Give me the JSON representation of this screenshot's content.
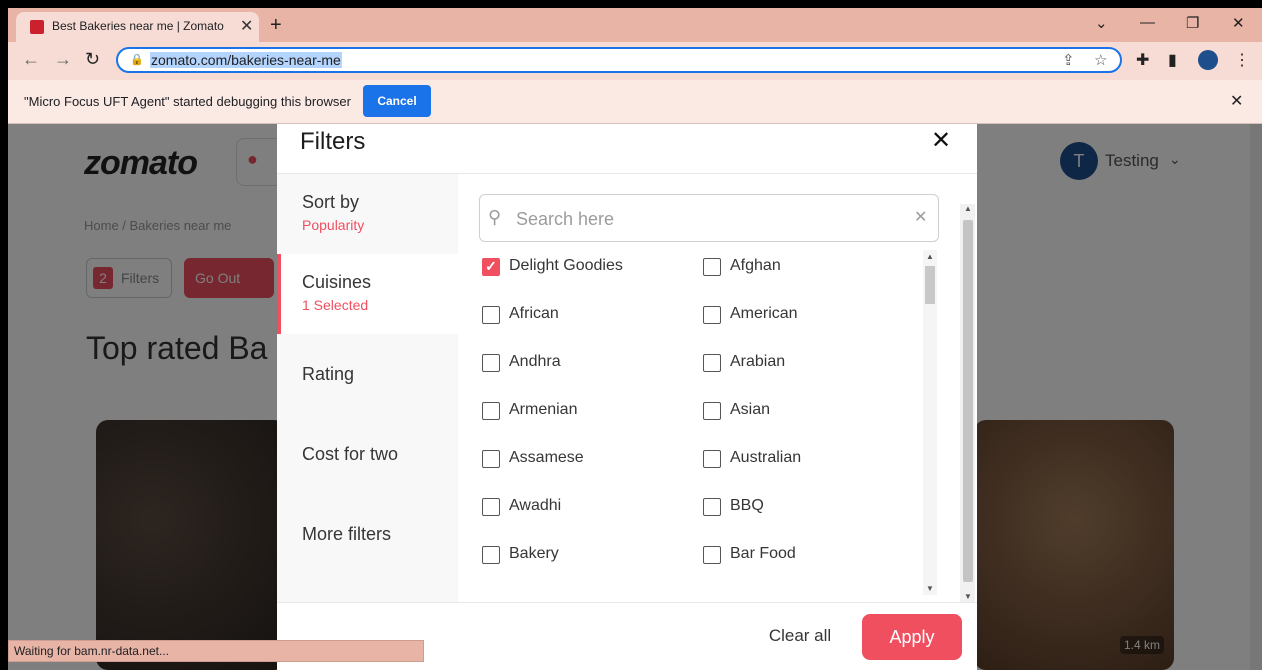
{
  "browser": {
    "tab_title": "Best Bakeries near me | Zomato",
    "url": "zomato.com/bakeries-near-me",
    "infobar_text": "\"Micro Focus UFT Agent\" started debugging this browser",
    "infobar_cancel": "Cancel",
    "status_text": "Waiting for bam.nr-data.net..."
  },
  "page": {
    "logo": "zomato",
    "user_initial": "T",
    "user_name": "Testing",
    "breadcrumb": "Home  /  Bakeries near me",
    "filters_count": "2",
    "filters_label": "Filters",
    "go_out_label": "Go Out",
    "heading": "Top rated Ba",
    "distance": "1.4 km"
  },
  "modal": {
    "title": "Filters",
    "sidebar": [
      {
        "label": "Sort by",
        "sub": "Popularity"
      },
      {
        "label": "Cuisines",
        "sub": "1 Selected"
      },
      {
        "label": "Rating",
        "sub": ""
      },
      {
        "label": "Cost for two",
        "sub": ""
      },
      {
        "label": "More filters",
        "sub": ""
      }
    ],
    "search_placeholder": "Search here",
    "options": [
      {
        "label": "Delight Goodies",
        "checked": true
      },
      {
        "label": "Afghan",
        "checked": false
      },
      {
        "label": "African",
        "checked": false
      },
      {
        "label": "American",
        "checked": false
      },
      {
        "label": "Andhra",
        "checked": false
      },
      {
        "label": "Arabian",
        "checked": false
      },
      {
        "label": "Armenian",
        "checked": false
      },
      {
        "label": "Asian",
        "checked": false
      },
      {
        "label": "Assamese",
        "checked": false
      },
      {
        "label": "Australian",
        "checked": false
      },
      {
        "label": "Awadhi",
        "checked": false
      },
      {
        "label": "BBQ",
        "checked": false
      },
      {
        "label": "Bakery",
        "checked": false
      },
      {
        "label": "Bar Food",
        "checked": false
      }
    ],
    "clear_all": "Clear all",
    "apply": "Apply"
  },
  "colors": {
    "accent": "#ef4f5f",
    "chrome_frame": "#e8b4a6",
    "link_blue": "#1a73e8"
  }
}
